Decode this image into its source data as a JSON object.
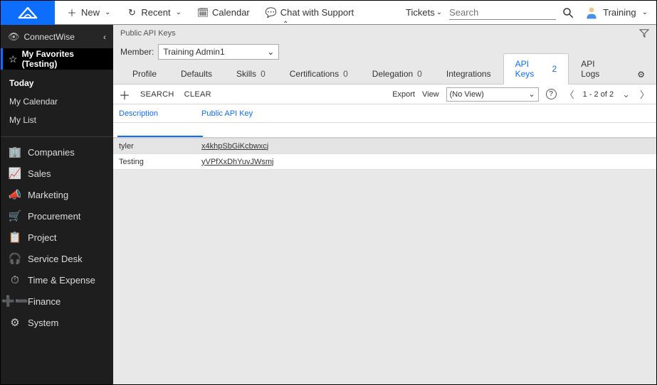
{
  "topbar": {
    "new_label": "New",
    "recent_label": "Recent",
    "calendar_label": "Calendar",
    "chat_label": "Chat with Support",
    "tickets_label": "Tickets",
    "search_placeholder": "Search",
    "user_label": "Training"
  },
  "sidebar": {
    "header": "ConnectWise",
    "favorites_label": "My Favorites (Testing)",
    "quick": {
      "today": "Today",
      "my_calendar": "My Calendar",
      "my_list": "My List"
    },
    "nav": [
      {
        "label": "Companies",
        "icon": "🏢"
      },
      {
        "label": "Sales",
        "icon": "📈"
      },
      {
        "label": "Marketing",
        "icon": "📣"
      },
      {
        "label": "Procurement",
        "icon": "🛒"
      },
      {
        "label": "Project",
        "icon": "📋"
      },
      {
        "label": "Service Desk",
        "icon": "🎧"
      },
      {
        "label": "Time & Expense",
        "icon": "⏱"
      },
      {
        "label": "Finance",
        "icon": "➕➖"
      },
      {
        "label": "System",
        "icon": "⚙"
      }
    ]
  },
  "main": {
    "breadcrumb": "Public API Keys",
    "member_label": "Member:",
    "member_value": "Training Admin1",
    "tabs": [
      {
        "label": "Profile",
        "count": ""
      },
      {
        "label": "Defaults",
        "count": ""
      },
      {
        "label": "Skills",
        "count": "0"
      },
      {
        "label": "Certifications",
        "count": "0"
      },
      {
        "label": "Delegation",
        "count": "0"
      },
      {
        "label": "Integrations",
        "count": ""
      },
      {
        "label": "API Keys",
        "count": "2"
      },
      {
        "label": "API Logs",
        "count": ""
      }
    ],
    "toolbar": {
      "search_label": "SEARCH",
      "clear_label": "CLEAR",
      "export_label": "Export",
      "view_label": "View",
      "view_value": "(No View)",
      "pager_text": "1 - 2 of 2"
    },
    "grid": {
      "columns": {
        "description": "Description",
        "public_key": "Public API Key"
      },
      "rows": [
        {
          "description": "tyler",
          "key": "x4khpSbGiKcbwxcj"
        },
        {
          "description": "Testing",
          "key": "yVPfXxDhYuvJWsmj"
        }
      ]
    }
  }
}
